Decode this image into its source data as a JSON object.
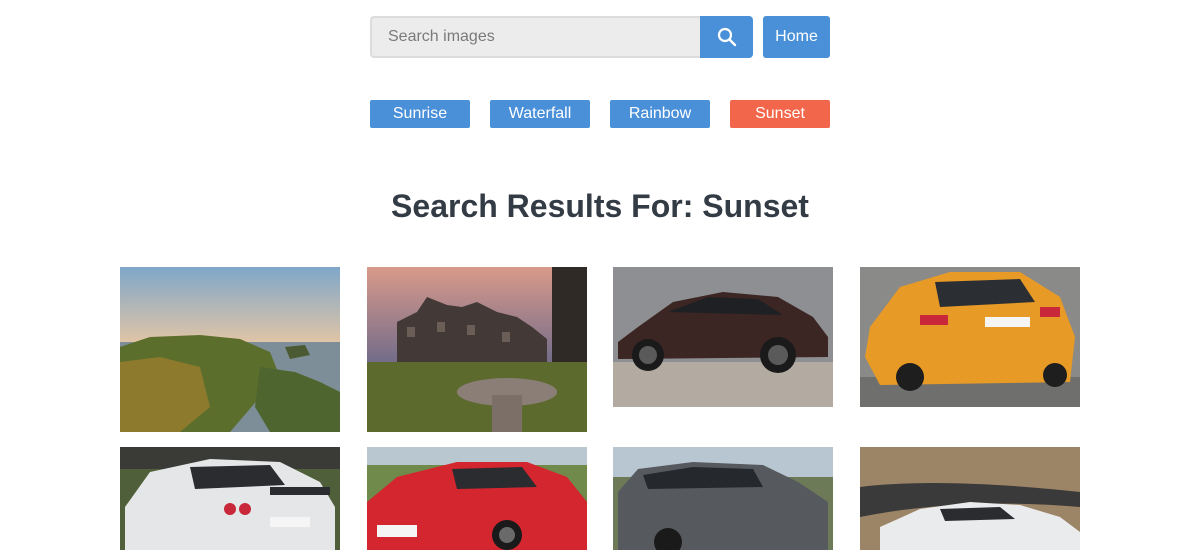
{
  "search": {
    "placeholder": "Search images",
    "value": "",
    "button_icon": "search-icon"
  },
  "nav": {
    "home_label": "Home"
  },
  "tags": [
    {
      "label": "Sunrise",
      "active": false
    },
    {
      "label": "Waterfall",
      "active": false
    },
    {
      "label": "Rainbow",
      "active": false
    },
    {
      "label": "Sunset",
      "active": true
    }
  ],
  "results": {
    "title": "Search Results For: Sunset",
    "images": [
      {
        "subject": "coastal cliffs at sunset"
      },
      {
        "subject": "castle at dusk with stone fountain"
      },
      {
        "subject": "dark brown luxury sedan"
      },
      {
        "subject": "orange hatchback rear view"
      },
      {
        "subject": "white sports car rear view"
      },
      {
        "subject": "red sports coupe"
      },
      {
        "subject": "grey SUV on road"
      },
      {
        "subject": "white sedan on winding road"
      }
    ]
  },
  "colors": {
    "primary": "#4a90d9",
    "active_tag": "#f2664b",
    "heading": "#333b45"
  }
}
